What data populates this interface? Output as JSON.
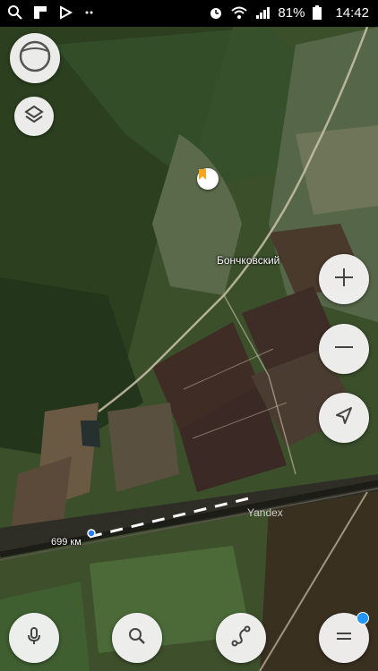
{
  "status_bar": {
    "battery": "81%",
    "time": "14:42",
    "icons": [
      "search-icon",
      "flipboard-icon",
      "play-icon",
      "more-icon",
      "alarm-icon",
      "wifi-icon",
      "signal-icon",
      "battery-icon"
    ]
  },
  "map": {
    "place_label": "Бончковский",
    "scale_label": "699 км",
    "brand_label": "Yandex",
    "poi_icon": "bookmark-icon"
  },
  "controls": {
    "top": [
      "compass-icon",
      "layers-icon"
    ],
    "right": [
      "zoom-in-icon",
      "zoom-out-icon",
      "my-location-icon"
    ],
    "bottom": [
      "microphone-icon",
      "search-icon",
      "route-icon",
      "menu-icon"
    ],
    "menu_badge_color": "#2196f3"
  },
  "colors": {
    "forest": "#2f4521",
    "field_dark": "#3a2b24",
    "road": "#c9c2a8"
  }
}
